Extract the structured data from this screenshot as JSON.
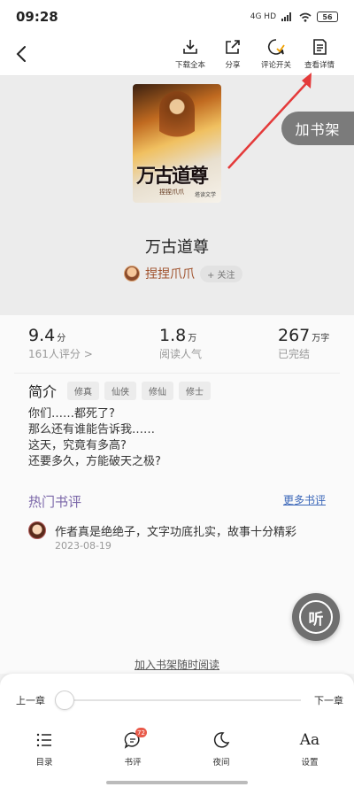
{
  "status_bar": {
    "time": "09:28",
    "network": "4G HD",
    "battery": "56"
  },
  "toolbar": {
    "download_label": "下载全本",
    "share_label": "分享",
    "comment_toggle_label": "评论开关",
    "details_label": "查看详情"
  },
  "add_to_shelf": "加书架",
  "cover": {
    "title_art": "万古道尊",
    "author_art": "捏捏爪爪",
    "publisher_art": "塔读文学"
  },
  "book": {
    "title": "万古道尊",
    "author": "捏捏爪爪",
    "follow_label": "+ 关注"
  },
  "stats": {
    "rating": {
      "value": "9.4",
      "unit": "分",
      "sub": "161人评分 >"
    },
    "popularity": {
      "value": "1.8",
      "unit": "万",
      "sub": "阅读人气"
    },
    "words": {
      "value": "267",
      "unit": "万字",
      "sub": "已完结"
    }
  },
  "intro": {
    "label": "简介",
    "tags": [
      "修真",
      "仙侠",
      "修仙",
      "修士"
    ],
    "lines": [
      "你们……都死了?",
      "那么还有谁能告诉我……",
      "这天，究竟有多高?",
      "还要多久，方能破天之极?"
    ]
  },
  "reviews": {
    "heading": "热门书评",
    "more_label": "更多书评",
    "items": [
      {
        "text": "作者真是绝绝子，文字功底扎实，故事十分精彩",
        "date": "2023-08-19"
      }
    ]
  },
  "listen_label": "听",
  "read_prompt": "加入书架随时阅读",
  "chapter_nav": {
    "prev": "上一章",
    "next": "下一章"
  },
  "bottom_nav": {
    "catalog": "目录",
    "reviews": "书评",
    "reviews_badge": "72",
    "night": "夜间",
    "settings": "设置",
    "settings_glyph": "Aa"
  }
}
